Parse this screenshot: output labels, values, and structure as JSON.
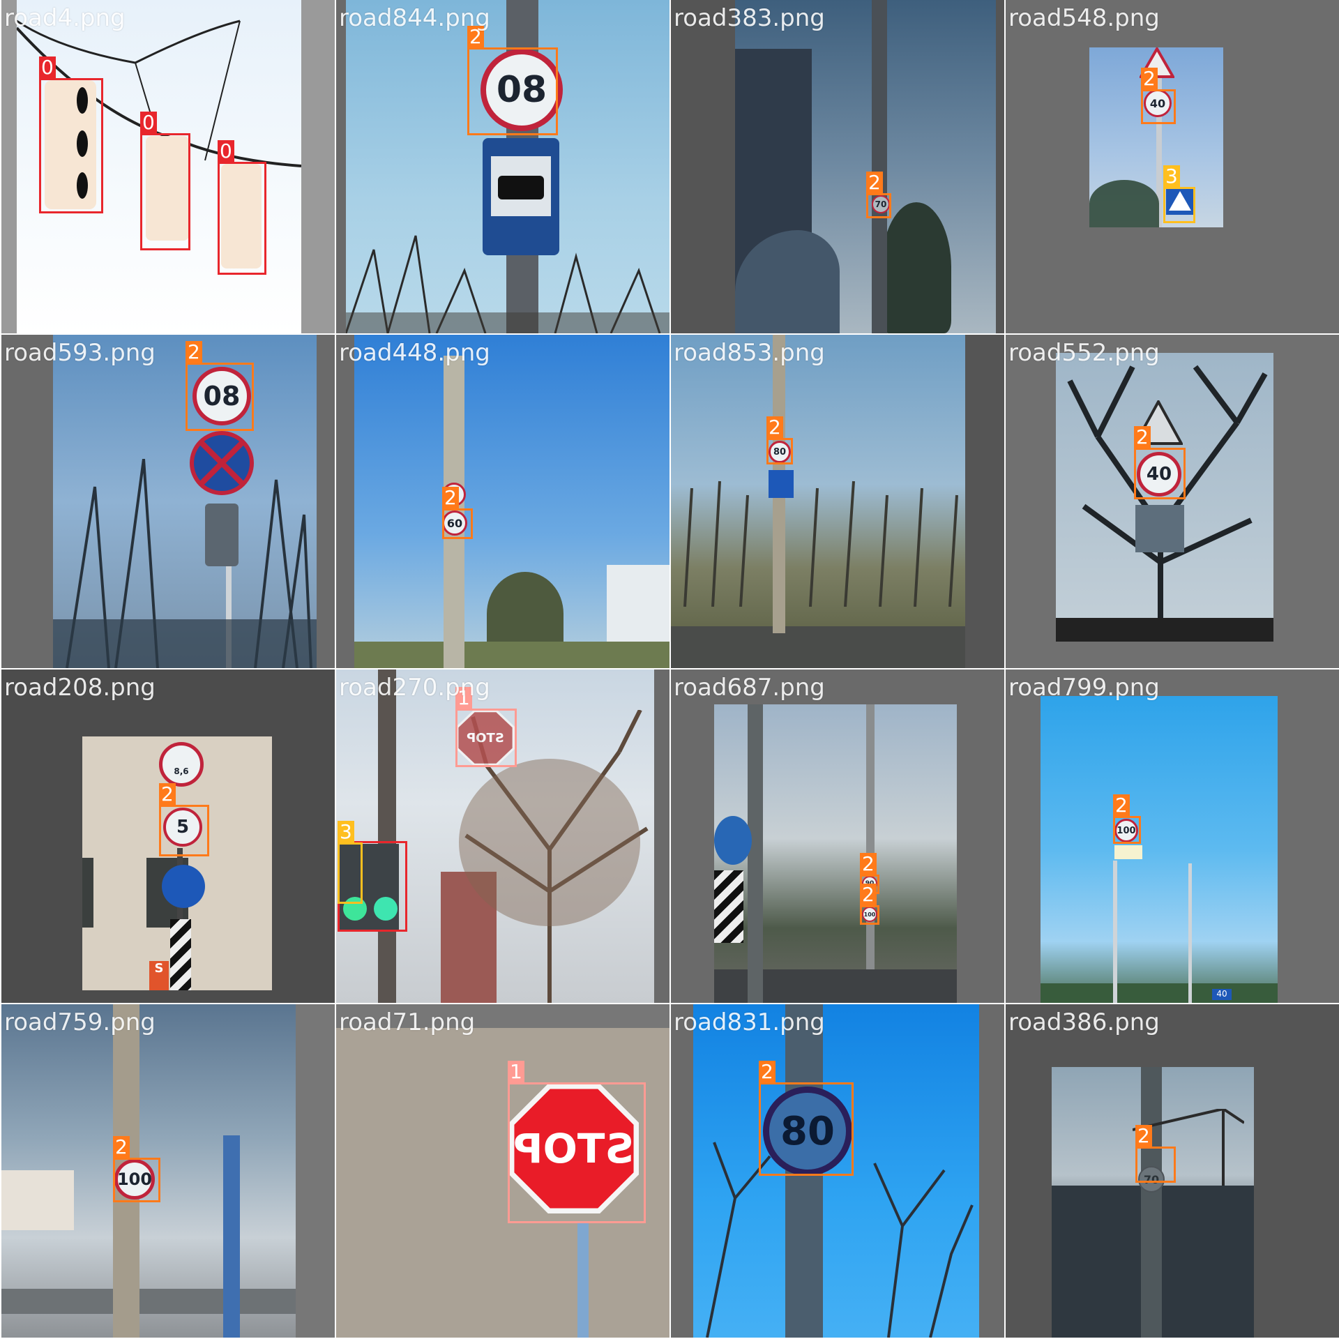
{
  "grid": {
    "rows": 4,
    "columns": 4,
    "class_colors": {
      "0": "#e8262c",
      "1": "#ff9b93",
      "2": "#ff7a1a",
      "3": "#ffbf1f"
    }
  },
  "tiles": [
    {
      "filename": "road4.png",
      "labels": [
        "0",
        "0",
        "0"
      ]
    },
    {
      "filename": "road844.png",
      "labels": [
        "2"
      ],
      "sign_text": "08"
    },
    {
      "filename": "road383.png",
      "labels": [
        "2"
      ],
      "sign_text": "70"
    },
    {
      "filename": "road548.png",
      "labels": [
        "2",
        "3"
      ],
      "sign_text": "40"
    },
    {
      "filename": "road593.png",
      "labels": [
        "2"
      ],
      "sign_text": "08"
    },
    {
      "filename": "road448.png",
      "labels": [
        "2"
      ],
      "sign_text": "60"
    },
    {
      "filename": "road853.png",
      "labels": [
        "2"
      ],
      "sign_text": "80"
    },
    {
      "filename": "road552.png",
      "labels": [
        "2"
      ],
      "sign_text": "40"
    },
    {
      "filename": "road208.png",
      "labels": [
        "2"
      ],
      "sign_text": "5",
      "extra_text": "8,6",
      "extra_text_2": "S"
    },
    {
      "filename": "road270.png",
      "labels": [
        "1",
        "3"
      ],
      "sign_text": "STOP"
    },
    {
      "filename": "road687.png",
      "labels": [
        "2",
        "2"
      ],
      "sign_text": "90",
      "sign_text_2": "100"
    },
    {
      "filename": "road799.png",
      "labels": [
        "2"
      ],
      "sign_text": "100",
      "extra_text": "40"
    },
    {
      "filename": "road759.png",
      "labels": [
        "2"
      ],
      "sign_text": "100"
    },
    {
      "filename": "road71.png",
      "labels": [
        "1"
      ],
      "sign_text": "STOP"
    },
    {
      "filename": "road831.png",
      "labels": [
        "2"
      ],
      "sign_text": "80"
    },
    {
      "filename": "road386.png",
      "labels": [
        "2"
      ],
      "sign_text": "70"
    }
  ]
}
